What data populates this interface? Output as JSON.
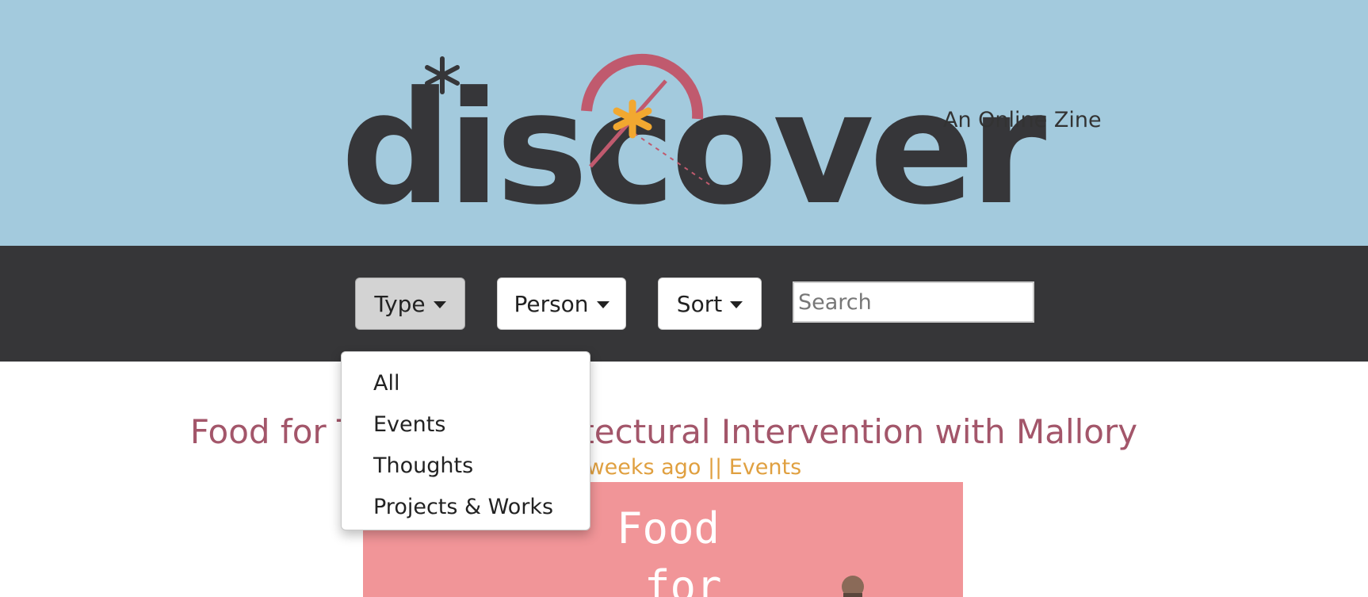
{
  "header": {
    "logo_text": "discover",
    "tagline": "An Online Zine"
  },
  "filters": {
    "type_label": "Type",
    "person_label": "Person",
    "sort_label": "Sort",
    "search_placeholder": "Search"
  },
  "type_menu": {
    "items": [
      "All",
      "Events",
      "Thoughts",
      "Projects & Works"
    ]
  },
  "post": {
    "title": "Food for Thought: Architectural Intervention with Mallory",
    "meta": "2 weeks ago || Events",
    "image_text_line1": "Food",
    "image_text_line2": "for"
  },
  "colors": {
    "header_bg": "#a3cadd",
    "bar_bg": "#363638",
    "title": "#a3566a",
    "meta": "#e0a040",
    "image_bg": "#f19598"
  }
}
